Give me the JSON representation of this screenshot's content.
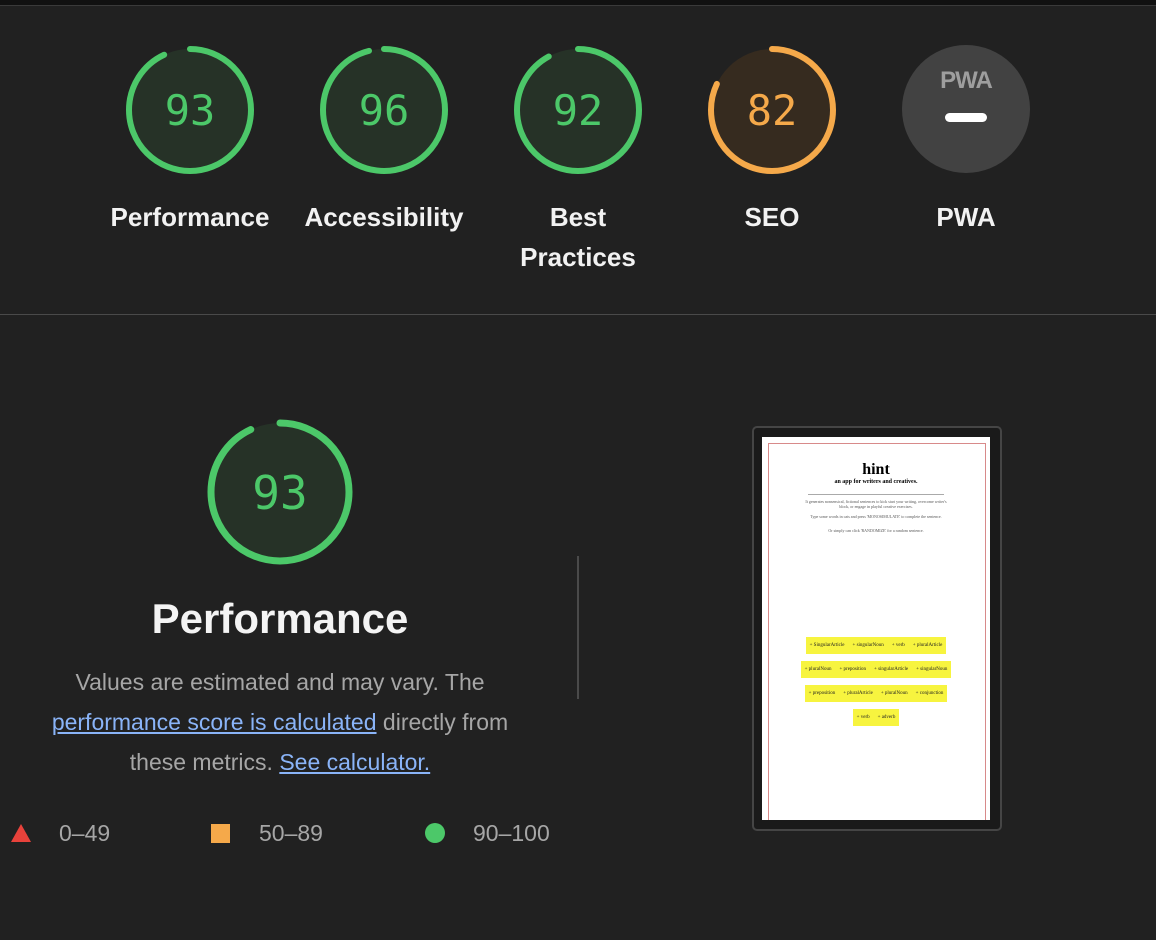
{
  "categories": [
    {
      "label": "Performance",
      "score": "93",
      "value": 93,
      "color": "#4cc869",
      "fill": "#263227"
    },
    {
      "label": "Accessibility",
      "score": "96",
      "value": 96,
      "color": "#4cc869",
      "fill": "#263227"
    },
    {
      "label_line1": "Best",
      "label_line2": "Practices",
      "score": "92",
      "value": 92,
      "color": "#4cc869",
      "fill": "#263227"
    },
    {
      "label": "SEO",
      "score": "82",
      "value": 82,
      "color": "#f5a94a",
      "fill": "#362b1f"
    },
    {
      "label": "PWA",
      "badge": "PWA",
      "color": "#424242"
    }
  ],
  "performance": {
    "score": "93",
    "value": 93,
    "title": "Performance",
    "desc_part1": "Values are estimated and may vary. The",
    "desc_link1": "performance score is calculated",
    "desc_part2": "directly from",
    "desc_part3": "these metrics.",
    "desc_link2": "See calculator."
  },
  "legend": {
    "fail": "0–49",
    "average": "50–89",
    "pass": "90–100"
  },
  "thumbnail": {
    "title": "hint",
    "subtitle": "an app for writers and creatives.",
    "para1": "It generates nonsensical, fictional sentences to kick start your writing, overcome writer's block, or engage in playful creative exercises.",
    "para2": "Type some words in cats and press 'MONOSIMULATE' to complete the sentence.",
    "para3": "Or simply can click 'RANDOMIZE' for a random sentence.",
    "rows": [
      [
        "+ SingularArticle",
        "+ singularNoun",
        "+ verb",
        "+ pluralArticle"
      ],
      [
        "+ pluralNoun",
        "+ preposition",
        "+ singularArticle",
        "+ singularNoun"
      ],
      [
        "+ preposition",
        "+ pluralArticle",
        "+ pluralNoun",
        "+ conjunction"
      ],
      [
        "+ verb",
        "+ adverb"
      ]
    ]
  }
}
